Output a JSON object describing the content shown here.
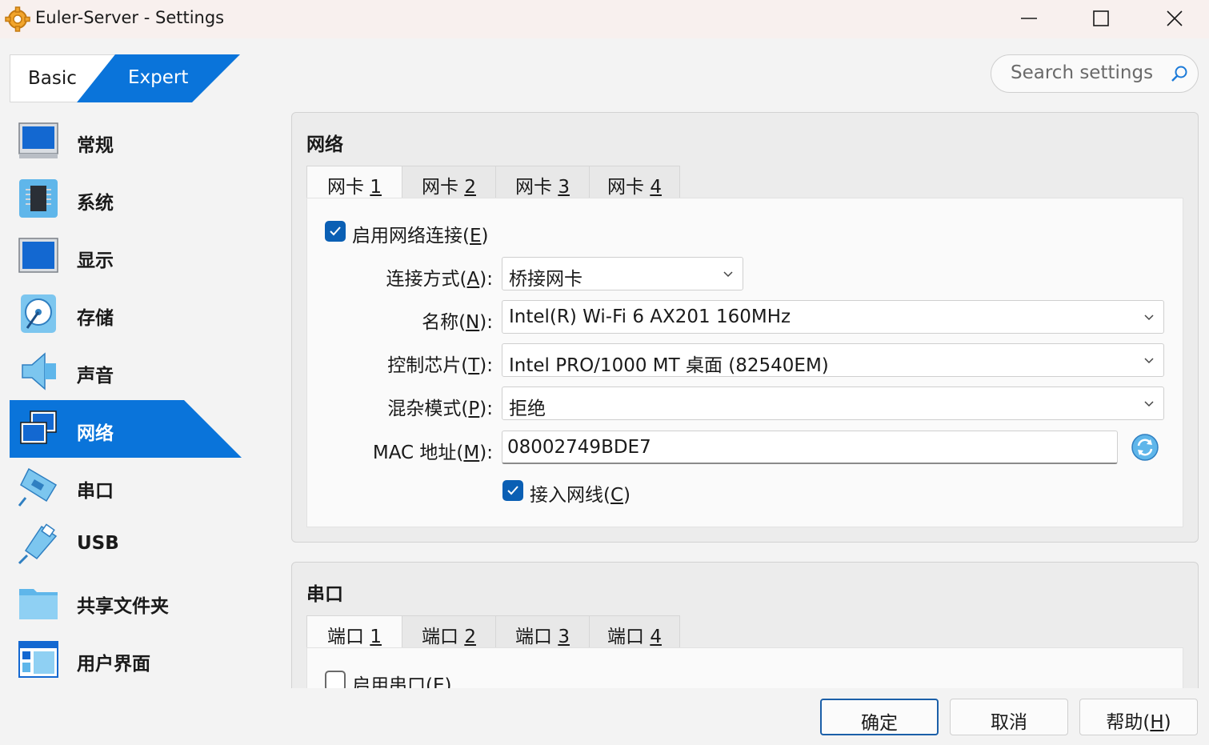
{
  "window": {
    "title": "Euler-Server - Settings",
    "app_icon": "gear-icon"
  },
  "mode": {
    "basic_label": "Basic",
    "expert_label": "Expert",
    "selected": "Expert"
  },
  "search": {
    "placeholder": "Search settings",
    "icon": "search-icon"
  },
  "sidebar": {
    "items": [
      {
        "label": "常规",
        "icon": "monitor-icon",
        "active": false
      },
      {
        "label": "系统",
        "icon": "chip-icon",
        "active": false
      },
      {
        "label": "显示",
        "icon": "display-icon",
        "active": false
      },
      {
        "label": "存储",
        "icon": "disk-icon",
        "active": false
      },
      {
        "label": "声音",
        "icon": "speaker-icon",
        "active": false
      },
      {
        "label": "网络",
        "icon": "network-icon",
        "active": true
      },
      {
        "label": "串口",
        "icon": "serial-port-icon",
        "active": false
      },
      {
        "label": "USB",
        "icon": "usb-icon",
        "active": false
      },
      {
        "label": "共享文件夹",
        "icon": "folder-icon",
        "active": false
      },
      {
        "label": "用户界面",
        "icon": "ui-window-icon",
        "active": false
      }
    ]
  },
  "network": {
    "title": "网络",
    "tabs": [
      {
        "prefix": "网卡 ",
        "num": "1",
        "active": true
      },
      {
        "prefix": "网卡 ",
        "num": "2",
        "active": false
      },
      {
        "prefix": "网卡 ",
        "num": "3",
        "active": false
      },
      {
        "prefix": "网卡 ",
        "num": "4",
        "active": false
      }
    ],
    "enable": {
      "label_pre": "启用网络连接(",
      "key": "E",
      "label_post": ")",
      "checked": true
    },
    "attached": {
      "label_pre": "连接方式(",
      "key": "A",
      "label_post": "):",
      "value": "桥接网卡"
    },
    "name": {
      "label_pre": "名称(",
      "key": "N",
      "label_post": "):",
      "value": "Intel(R) Wi-Fi 6 AX201 160MHz"
    },
    "adapter": {
      "label_pre": "控制芯片(",
      "key": "T",
      "label_post": "):",
      "value": "Intel PRO/1000 MT 桌面 (82540EM)"
    },
    "promisc": {
      "label_pre": "混杂模式(",
      "key": "P",
      "label_post": "):",
      "value": "拒绝"
    },
    "mac": {
      "label_pre": "MAC 地址(",
      "key": "M",
      "label_post": "):",
      "value": "08002749BDE7"
    },
    "cable": {
      "label_pre": "接入网线(",
      "key": "C",
      "label_post": ")",
      "checked": true
    }
  },
  "serial": {
    "title": "串口",
    "tabs": [
      {
        "prefix": "端口 ",
        "num": "1",
        "active": true
      },
      {
        "prefix": "端口 ",
        "num": "2",
        "active": false
      },
      {
        "prefix": "端口 ",
        "num": "3",
        "active": false
      },
      {
        "prefix": "端口 ",
        "num": "4",
        "active": false
      }
    ],
    "enable": {
      "label": "启用串口(E)",
      "checked": false
    }
  },
  "buttons": {
    "ok": "确定",
    "cancel": "取消",
    "help_pre": "帮助(",
    "help_key": "H",
    "help_post": ")"
  },
  "colors": {
    "accent": "#0a74da",
    "checkbox": "#0a5fb4"
  }
}
